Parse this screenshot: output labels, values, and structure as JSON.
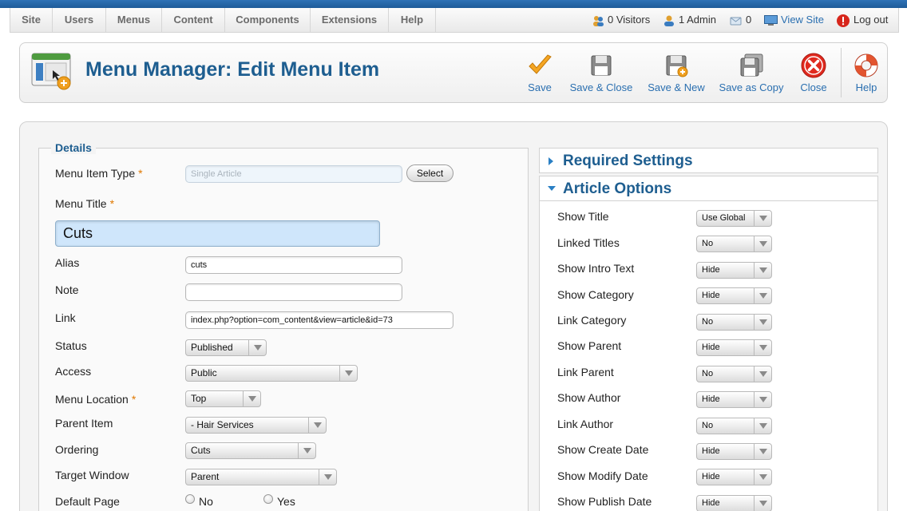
{
  "menubar": {
    "items": [
      "Site",
      "Users",
      "Menus",
      "Content",
      "Components",
      "Extensions",
      "Help"
    ],
    "visitors": "0 Visitors",
    "admins": "1 Admin",
    "messages": "0",
    "view_site": "View Site",
    "logout": "Log out"
  },
  "toolbar": {
    "title": "Menu Manager: Edit Menu Item",
    "buttons": [
      "Save",
      "Save & Close",
      "Save & New",
      "Save as Copy",
      "Close",
      "Help"
    ]
  },
  "details": {
    "legend": "Details",
    "menu_item_type_label": "Menu Item Type",
    "menu_item_type_value": "Single Article",
    "select_label": "Select",
    "menu_title_label": "Menu Title",
    "menu_title_value": "Cuts",
    "alias_label": "Alias",
    "alias_value": "cuts",
    "note_label": "Note",
    "note_value": "",
    "link_label": "Link",
    "link_value": "index.php?option=com_content&view=article&id=73",
    "status_label": "Status",
    "status_value": "Published",
    "access_label": "Access",
    "access_value": "Public",
    "menu_location_label": "Menu Location",
    "menu_location_value": "Top",
    "parent_item_label": "Parent Item",
    "parent_item_value": "- Hair Services",
    "ordering_label": "Ordering",
    "ordering_value": "Cuts",
    "target_window_label": "Target Window",
    "target_window_value": "Parent",
    "default_page_label": "Default Page",
    "default_page_no": "No",
    "default_page_yes": "Yes",
    "required_marker": "*"
  },
  "panels": {
    "required_settings": "Required Settings",
    "article_options": "Article Options"
  },
  "article_options": [
    {
      "label": "Show Title",
      "value": "Use Global"
    },
    {
      "label": "Linked Titles",
      "value": "No"
    },
    {
      "label": "Show Intro Text",
      "value": "Hide"
    },
    {
      "label": "Show Category",
      "value": "Hide"
    },
    {
      "label": "Link Category",
      "value": "No"
    },
    {
      "label": "Show Parent",
      "value": "Hide"
    },
    {
      "label": "Link Parent",
      "value": "No"
    },
    {
      "label": "Show Author",
      "value": "Hide"
    },
    {
      "label": "Link Author",
      "value": "No"
    },
    {
      "label": "Show Create Date",
      "value": "Hide"
    },
    {
      "label": "Show Modify Date",
      "value": "Hide"
    },
    {
      "label": "Show Publish Date",
      "value": "Hide"
    }
  ],
  "colors": {
    "accent_blue": "#1e5e90",
    "link_blue": "#2a6fb0",
    "required_orange": "#e07800",
    "close_red": "#e02a1f"
  }
}
